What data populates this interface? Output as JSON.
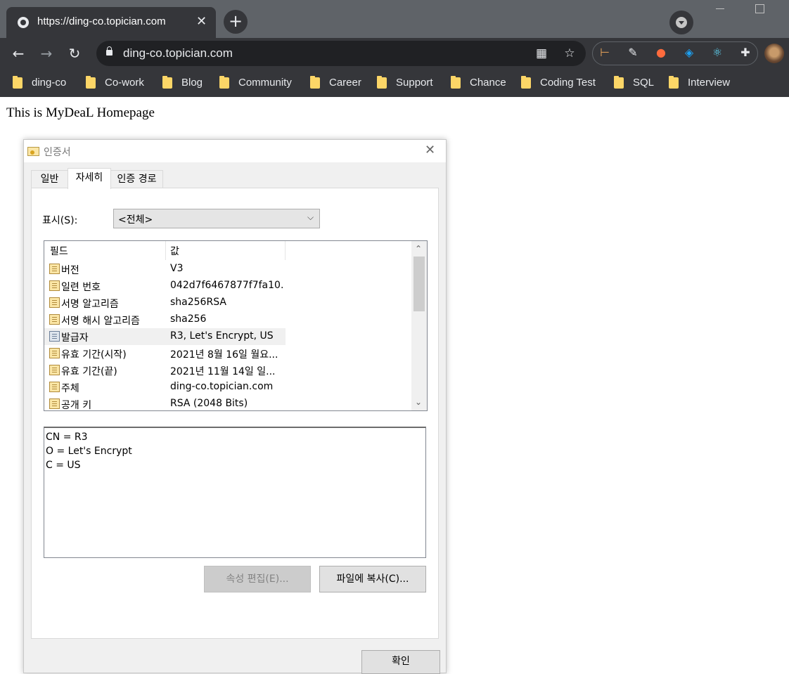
{
  "browser": {
    "tab_title": "https://ding-co.topician.com",
    "tab_close": "✕",
    "new_tab": "+",
    "nav": {
      "back": "←",
      "forward": "→",
      "reload": "↻"
    },
    "url": "ding-co.topician.com",
    "omnibox_icons": {
      "qr": "▦",
      "star": "☆"
    },
    "extensions": [
      {
        "name": "ruler-extension-icon",
        "glyph": "⊢",
        "color": "#e8a35a"
      },
      {
        "name": "pen-extension-icon",
        "glyph": "✎",
        "color": "#e8eaed"
      },
      {
        "name": "color-wheel-extension-icon",
        "glyph": "●",
        "color": "#ff6b3d"
      },
      {
        "name": "twitter-extension-icon",
        "glyph": "◈",
        "color": "#1da1f2"
      },
      {
        "name": "react-extension-icon",
        "glyph": "⚛",
        "color": "#61dafb"
      },
      {
        "name": "puzzle-extension-icon",
        "glyph": "✚",
        "color": "#e8eaed"
      }
    ]
  },
  "bookmarks": [
    "ding-co",
    "Co-work",
    "Blog",
    "Community",
    "Career",
    "Support",
    "Chance",
    "Coding Test",
    "SQL",
    "Interview"
  ],
  "page": {
    "heading": "This is MyDeaL Homepage"
  },
  "dialog": {
    "title": "인증서",
    "close": "✕",
    "tabs": [
      "일반",
      "자세히",
      "인증 경로"
    ],
    "active_tab": "자세히",
    "show_label": "표시(S):",
    "show_value": "<전체>",
    "show_caret": "⌵",
    "columns": {
      "field": "필드",
      "value": "값"
    },
    "rows": [
      {
        "field": "버전",
        "value": "V3"
      },
      {
        "field": "일련 번호",
        "value": "042d7f6467877f7fa10..."
      },
      {
        "field": "서명 알고리즘",
        "value": "sha256RSA"
      },
      {
        "field": "서명 해시 알고리즘",
        "value": "sha256"
      },
      {
        "field": "발급자",
        "value": "R3, Let's Encrypt, US"
      },
      {
        "field": "유효 기간(시작)",
        "value": "2021년 8월 16일 월요..."
      },
      {
        "field": "유효 기간(끝)",
        "value": "2021년 11월 14일 일..."
      },
      {
        "field": "주체",
        "value": "ding-co.topician.com"
      },
      {
        "field": "공개 키",
        "value": "RSA (2048 Bits)"
      }
    ],
    "selected_row": 4,
    "detail_lines": [
      "CN = R3",
      "O = Let's Encrypt",
      "C = US"
    ],
    "buttons": {
      "edit": "속성 편집(E)...",
      "copy": "파일에 복사(C)...",
      "ok": "확인"
    }
  }
}
